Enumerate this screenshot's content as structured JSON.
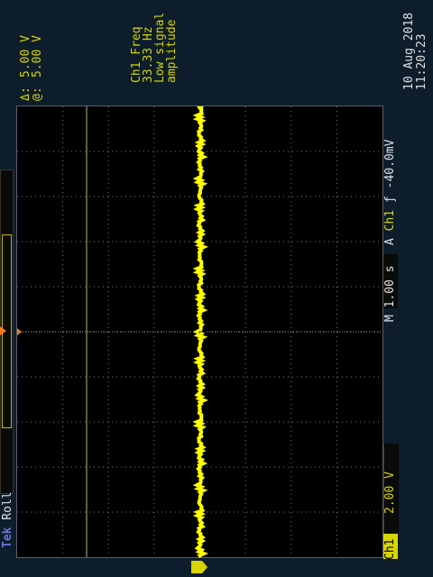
{
  "cursor": {
    "delta_label": "Δ:",
    "delta_value": "5.00 V",
    "at_label": "@:",
    "at_value": "5.00 V"
  },
  "measurement": {
    "line1": "Ch1 Freq",
    "line2": "33.33 Hz",
    "line3": "Low signal",
    "line4": "amplitude"
  },
  "datetime": {
    "date": "10 Aug 2018",
    "time": "11:20:23"
  },
  "acquisition": {
    "brand": "Tek",
    "mode": "Roll"
  },
  "channel1": {
    "label": "Ch1",
    "scale": "2.00 V",
    "ground_marker": "1",
    "color": "#d8d400"
  },
  "timebase": {
    "label": "M 1.00 s"
  },
  "trigger": {
    "mode": "A",
    "source": "Ch1",
    "slope_symbol": "ƒ",
    "level": "-40.0mV"
  },
  "colors": {
    "background": "#0d1d2b",
    "trace": "#ffff00",
    "graticule": "#7a7a7a",
    "trigger_marker": "#ff7a1a"
  }
}
